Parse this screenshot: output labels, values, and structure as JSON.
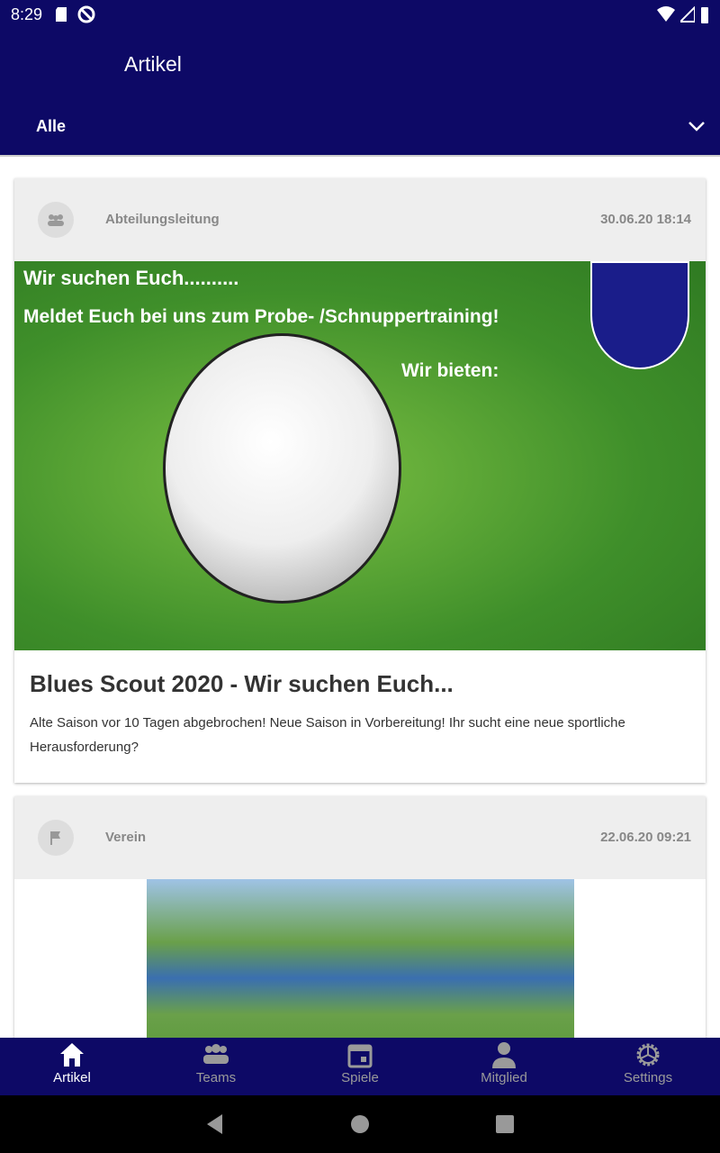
{
  "status": {
    "time": "8:29"
  },
  "appbar": {
    "title": "Artikel",
    "filter": "Alle"
  },
  "articles": [
    {
      "category": "Abteilungsleitung",
      "date": "30.06.20 18:14",
      "title": "Blues Scout 2020 - Wir suchen Euch...",
      "body": "Alte Saison vor 10 Tagen abgebrochen! Neue Saison in Vorbereitung! Ihr sucht eine neue sportliche Herausforderung?",
      "image_text": [
        "Wir suchen Euch..........",
        "Meldet Euch bei uns zum Probe- /Schnuppertraining!",
        "Wir bieten:"
      ]
    },
    {
      "category": "Verein",
      "date": "22.06.20 09:21"
    }
  ],
  "bottom_nav": [
    {
      "label": "Artikel",
      "icon": "home-icon",
      "active": true
    },
    {
      "label": "Teams",
      "icon": "group-icon"
    },
    {
      "label": "Spiele",
      "icon": "calendar-icon"
    },
    {
      "label": "Mitglied",
      "icon": "person-icon"
    },
    {
      "label": "Settings",
      "icon": "gear-icon"
    }
  ],
  "colors": {
    "primary": "#0d0966",
    "inactive": "#9a9a9a"
  }
}
